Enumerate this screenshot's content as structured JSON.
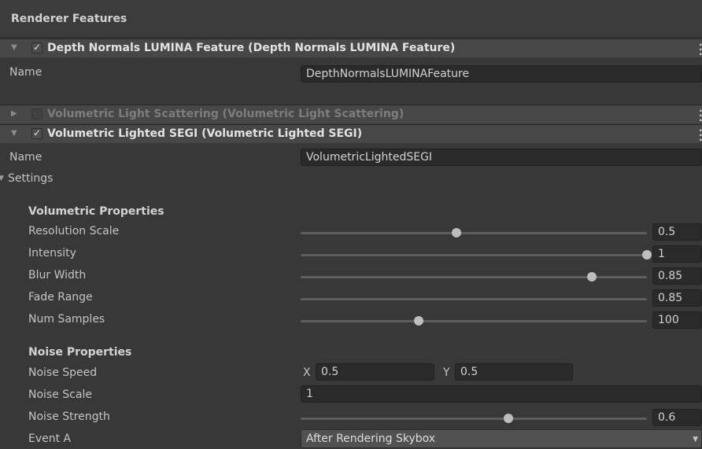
{
  "header": {
    "title": "Renderer Features"
  },
  "features": [
    {
      "title": "Depth Normals LUMINA Feature (Depth Normals LUMINA Feature)",
      "checked": true,
      "expanded": true,
      "name_label": "Name",
      "name_value": "DepthNormalsLUMINAFeature"
    },
    {
      "title": "Volumetric Light Scattering (Volumetric Light Scattering)",
      "checked": false,
      "expanded": false
    },
    {
      "title": "Volumetric Lighted SEGI (Volumetric Lighted SEGI)",
      "checked": true,
      "expanded": true,
      "name_label": "Name",
      "name_value": "VolumetricLightedSEGI"
    }
  ],
  "settings_label": "Settings",
  "volumetric": {
    "section": "Volumetric Properties",
    "sliders": [
      {
        "label": "Resolution Scale",
        "value": "0.5",
        "fraction": 0.45
      },
      {
        "label": "Intensity",
        "value": "1",
        "fraction": 1.0
      },
      {
        "label": "Blur Width",
        "value": "0.85",
        "fraction": 0.84
      },
      {
        "label": "Fade Range",
        "value": "0.85",
        "fraction": null
      },
      {
        "label": "Num Samples",
        "value": "100",
        "fraction": 0.34
      }
    ]
  },
  "noise": {
    "section": "Noise Properties",
    "speed_label": "Noise Speed",
    "speed_x_label": "X",
    "speed_x": "0.5",
    "speed_y_label": "Y",
    "speed_y": "0.5",
    "scale_label": "Noise Scale",
    "scale_value": "1",
    "strength_label": "Noise Strength",
    "strength_value": "0.6",
    "strength_fraction": 0.6
  },
  "event": {
    "label": "Event A",
    "value": "After Rendering Skybox"
  },
  "icons": {
    "checkbox": "check-icon",
    "foldout_open": "triangle-down-icon",
    "foldout_closed": "triangle-right-icon",
    "menu": "kebab-menu-icon"
  }
}
